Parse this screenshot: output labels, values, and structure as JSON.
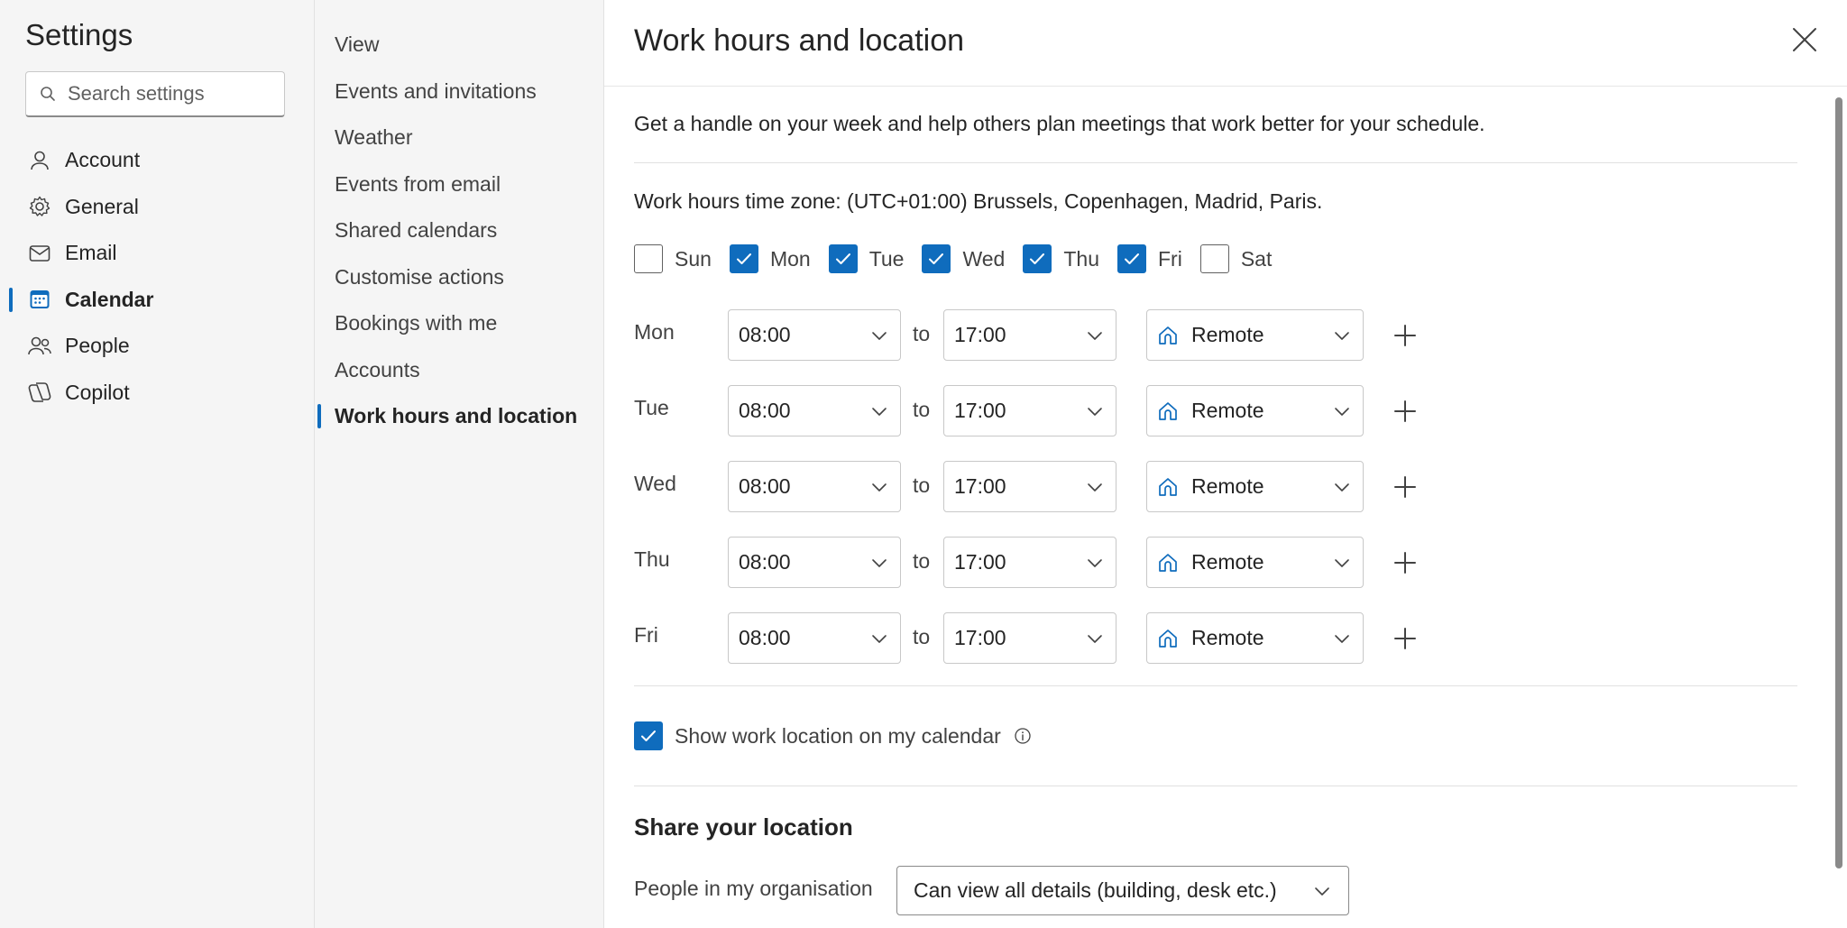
{
  "sidebar": {
    "title": "Settings",
    "search_placeholder": "Search settings",
    "items": [
      {
        "label": "Account",
        "icon": "person-icon"
      },
      {
        "label": "General",
        "icon": "gear-icon"
      },
      {
        "label": "Email",
        "icon": "mail-icon"
      },
      {
        "label": "Calendar",
        "icon": "calendar-icon",
        "active": true
      },
      {
        "label": "People",
        "icon": "people-icon"
      },
      {
        "label": "Copilot",
        "icon": "copilot-icon"
      }
    ]
  },
  "subnav": {
    "items": [
      {
        "label": "View"
      },
      {
        "label": "Events and invitations"
      },
      {
        "label": "Weather"
      },
      {
        "label": "Events from email"
      },
      {
        "label": "Shared calendars"
      },
      {
        "label": "Customise actions"
      },
      {
        "label": "Bookings with me"
      },
      {
        "label": "Accounts"
      },
      {
        "label": "Work hours and location",
        "active": true
      }
    ]
  },
  "main": {
    "title": "Work hours and location",
    "description": "Get a handle on your week and help others plan meetings that work better for your schedule.",
    "timezone": "Work hours time zone: (UTC+01:00) Brussels, Copenhagen, Madrid, Paris.",
    "days": [
      {
        "label": "Sun",
        "checked": false
      },
      {
        "label": "Mon",
        "checked": true
      },
      {
        "label": "Tue",
        "checked": true
      },
      {
        "label": "Wed",
        "checked": true
      },
      {
        "label": "Thu",
        "checked": true
      },
      {
        "label": "Fri",
        "checked": true
      },
      {
        "label": "Sat",
        "checked": false
      }
    ],
    "to_label": "to",
    "hours": [
      {
        "day": "Mon",
        "start": "08:00",
        "end": "17:00",
        "location": "Remote"
      },
      {
        "day": "Tue",
        "start": "08:00",
        "end": "17:00",
        "location": "Remote"
      },
      {
        "day": "Wed",
        "start": "08:00",
        "end": "17:00",
        "location": "Remote"
      },
      {
        "day": "Thu",
        "start": "08:00",
        "end": "17:00",
        "location": "Remote"
      },
      {
        "day": "Fri",
        "start": "08:00",
        "end": "17:00",
        "location": "Remote"
      }
    ],
    "show_location_label": "Show work location on my calendar",
    "show_location_checked": true,
    "share_title": "Share your location",
    "org_label": "People in my organisation",
    "org_value": "Can view all details (building, desk etc.)"
  },
  "colors": {
    "accent": "#0f6cbd",
    "nav_bg": "#f5f5f5"
  }
}
